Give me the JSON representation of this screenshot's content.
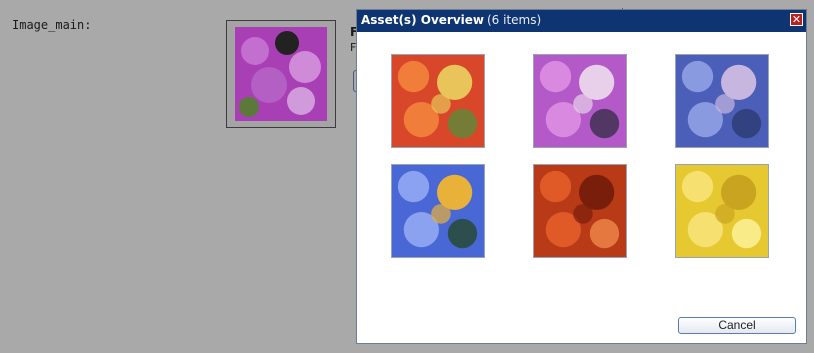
{
  "background": {
    "field_label": "Image_main:",
    "text_line1": "F",
    "text_line2": "F"
  },
  "modal": {
    "title": "Asset(s) Overview",
    "count": "(6 items)",
    "close_icon": "close-icon",
    "cancel_label": "Cancel",
    "assets": [
      {
        "name": "orange-red-flowers",
        "colors": [
          "#d8472a",
          "#f07d3a",
          "#e9c45a",
          "#5b8a3a"
        ]
      },
      {
        "name": "pink-purple-flowers",
        "colors": [
          "#b35ac8",
          "#d98ae0",
          "#e8d0ea",
          "#3a2d4a"
        ]
      },
      {
        "name": "blue-purple-flowers",
        "colors": [
          "#4c5fb8",
          "#8a9ae0",
          "#c7b6e0",
          "#2c3a70"
        ]
      },
      {
        "name": "blue-daisies",
        "colors": [
          "#4a67d6",
          "#8ba2f0",
          "#e8b13a",
          "#244a2a"
        ]
      },
      {
        "name": "red-lilies",
        "colors": [
          "#b83a16",
          "#e05a28",
          "#7a1e0c",
          "#f08848"
        ]
      },
      {
        "name": "yellow-daisies",
        "colors": [
          "#e6c830",
          "#f5e070",
          "#c9a420",
          "#fff4a0"
        ]
      }
    ]
  }
}
